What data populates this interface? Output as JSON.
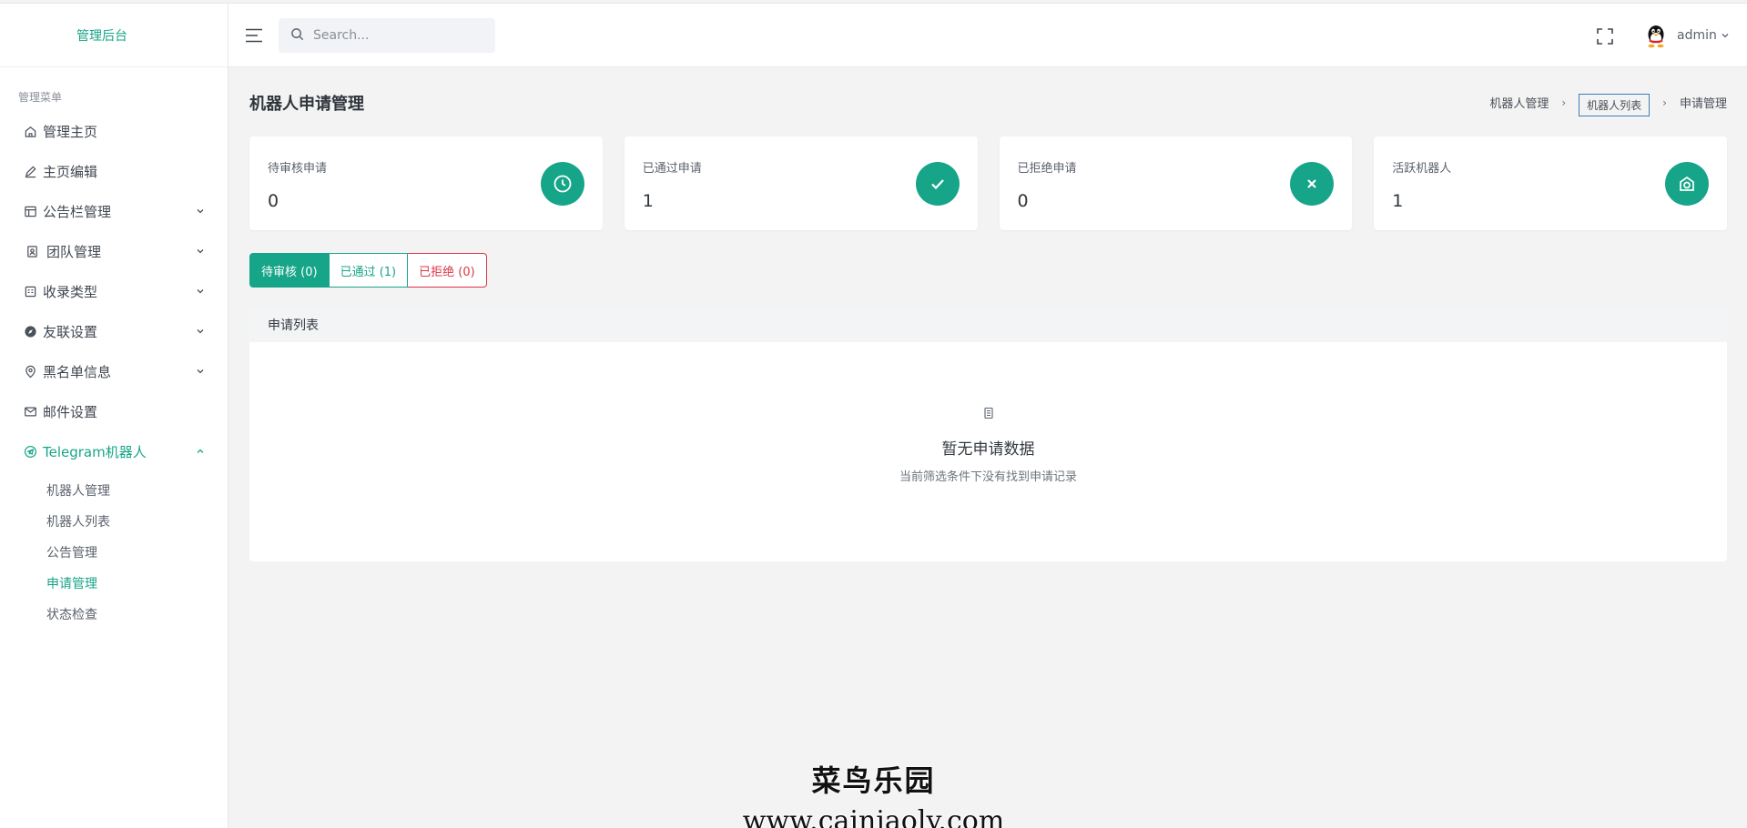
{
  "brand": "管理后台",
  "header": {
    "search_placeholder": "Search...",
    "user_name": "admin"
  },
  "sidebar": {
    "menu_title": "管理菜单",
    "items": [
      {
        "label": "管理主页",
        "icon": "home-icon"
      },
      {
        "label": "主页编辑",
        "icon": "pencil-icon"
      },
      {
        "label": "公告栏管理",
        "icon": "board-icon"
      },
      {
        "label": "团队管理",
        "icon": "team-icon"
      },
      {
        "label": "收录类型",
        "icon": "category-icon"
      },
      {
        "label": "友联设置",
        "icon": "compass-icon"
      },
      {
        "label": "黑名单信息",
        "icon": "location-icon"
      },
      {
        "label": "邮件设置",
        "icon": "mail-icon"
      },
      {
        "label": "Telegram机器人",
        "icon": "telegram-icon"
      }
    ],
    "sub_items": [
      {
        "label": "机器人管理"
      },
      {
        "label": "机器人列表"
      },
      {
        "label": "公告管理"
      },
      {
        "label": "申请管理"
      },
      {
        "label": "状态检查"
      }
    ]
  },
  "page": {
    "title": "机器人申请管理",
    "breadcrumb": [
      "机器人管理",
      "机器人列表",
      "申请管理"
    ]
  },
  "stats": [
    {
      "label": "待审核申请",
      "value": "0",
      "icon": "clock-icon"
    },
    {
      "label": "已通过申请",
      "value": "1",
      "icon": "check-icon"
    },
    {
      "label": "已拒绝申请",
      "value": "0",
      "icon": "close-icon"
    },
    {
      "label": "活跃机器人",
      "value": "1",
      "icon": "camera-icon"
    }
  ],
  "tabs": [
    {
      "label": "待审核 (0)"
    },
    {
      "label": "已通过 (1)"
    },
    {
      "label": "已拒绝 (0)"
    }
  ],
  "panel": {
    "title": "申请列表",
    "empty_title": "暂无申请数据",
    "empty_subtitle": "当前筛选条件下没有找到申请记录"
  },
  "watermark": {
    "line1": "菜鸟乐园",
    "line2": "www.cainiaoly.com"
  },
  "colors": {
    "accent": "#17a589",
    "danger": "#dc3545"
  }
}
